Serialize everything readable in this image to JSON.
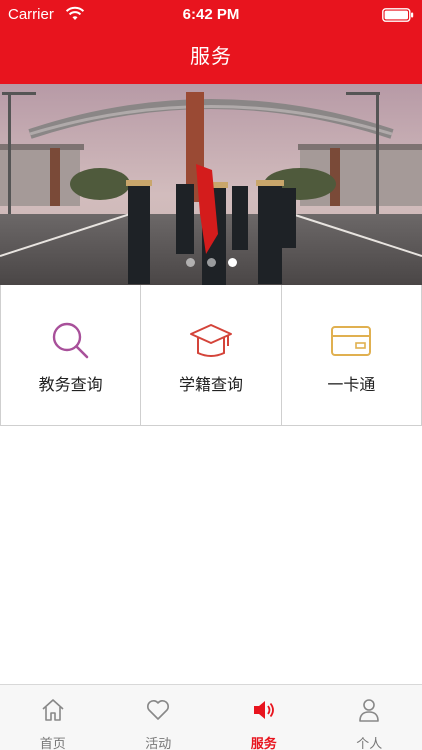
{
  "status_bar": {
    "carrier": "Carrier",
    "time": "6:42 PM",
    "icons": [
      "wifi-icon",
      "battery-icon"
    ]
  },
  "nav": {
    "title": "服务"
  },
  "banner": {
    "page_count": 3,
    "active_page": 3
  },
  "services": [
    {
      "label": "教务查询",
      "icon": "search-icon",
      "color": "#a8509a"
    },
    {
      "label": "学籍查询",
      "icon": "graduation-cap-icon",
      "color": "#d4443a"
    },
    {
      "label": "一卡通",
      "icon": "card-icon",
      "color": "#e0b050"
    }
  ],
  "tabbar": {
    "items": [
      {
        "label": "首页",
        "icon": "home-icon",
        "active": false
      },
      {
        "label": "活动",
        "icon": "heart-icon",
        "active": false
      },
      {
        "label": "服务",
        "icon": "speaker-icon",
        "active": true
      },
      {
        "label": "个人",
        "icon": "person-icon",
        "active": false
      }
    ]
  },
  "colors": {
    "brand_red": "#e8141e",
    "tab_inactive": "#777777"
  }
}
